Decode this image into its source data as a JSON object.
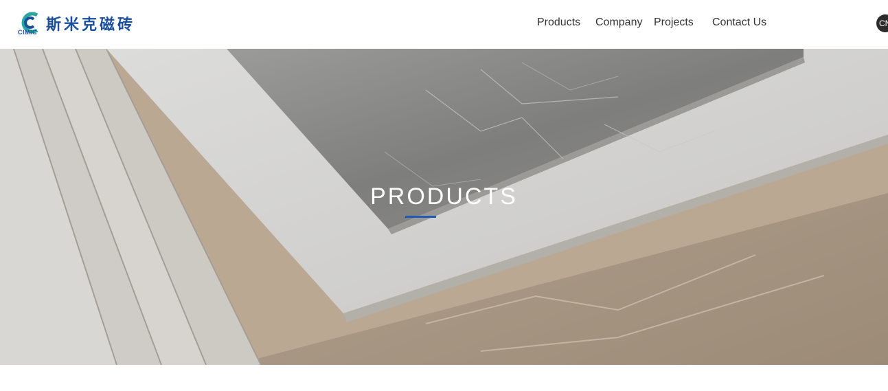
{
  "brand": {
    "logo_text": "斯米克磁砖",
    "logo_sub": "CIMIC",
    "color": "#1a4f9c",
    "accent": "#2aa6a0"
  },
  "nav": {
    "items": [
      {
        "label": "Products"
      },
      {
        "label": "Company"
      },
      {
        "label": "Projects"
      },
      {
        "label": "Contact Us"
      }
    ],
    "lang": "CN"
  },
  "hero": {
    "title": "PRODUCTS",
    "underline_color": "#1f5bb8"
  }
}
